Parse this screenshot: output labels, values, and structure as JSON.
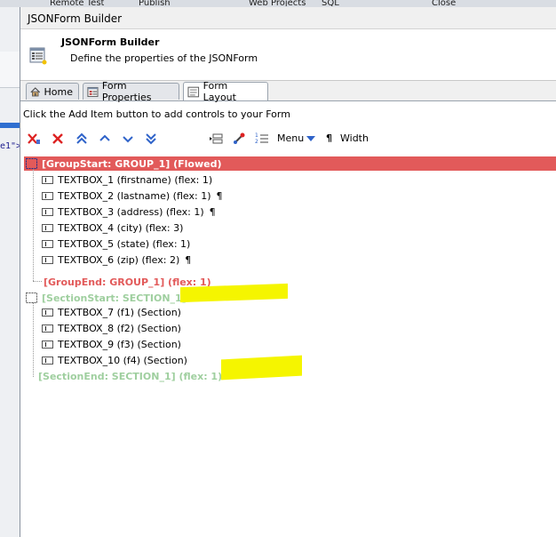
{
  "background": {
    "tabs": [
      "Remote Test",
      "Publish",
      "Web Projects",
      "SQL",
      "Close"
    ],
    "code_fragment": "e1\">"
  },
  "dialog": {
    "title": "JSONForm Builder",
    "banner_title": "JSONForm Builder",
    "banner_subtitle": "Define the properties of the JSONForm",
    "tabs": [
      {
        "label": "Home",
        "icon": "home-icon"
      },
      {
        "label": "Form Properties",
        "icon": "properties-icon"
      },
      {
        "label": "Form Layout",
        "icon": "layout-icon",
        "active": true
      }
    ],
    "hint": "Click the Add Item button to add controls to your Form",
    "toolbar": {
      "menu_label": "Menu",
      "pilcrow": "¶",
      "width_label": "Width"
    },
    "tree": {
      "group_start": "[GroupStart: GROUP_1] (Flowed)",
      "group_items": [
        {
          "label": "TEXTBOX_1 (firstname) (flex: 1)",
          "break": false
        },
        {
          "label": "TEXTBOX_2 (lastname) (flex: 1)",
          "break": true
        },
        {
          "label": "TEXTBOX_3 (address) (flex: 1)",
          "break": true
        },
        {
          "label": "TEXTBOX_4 (city) (flex: 3)",
          "break": false
        },
        {
          "label": "TEXTBOX_5 (state) (flex: 1)",
          "break": false
        },
        {
          "label": "TEXTBOX_6 (zip) (flex: 2)",
          "break": true
        }
      ],
      "group_end": "[GroupEnd: GROUP_1] (flex: 1)",
      "section_start": "[SectionStart: SECTION_1]",
      "section_items": [
        {
          "label": "TEXTBOX_7 (f1) (Section)"
        },
        {
          "label": "TEXTBOX_8 (f2) (Section)"
        },
        {
          "label": "TEXTBOX_9 (f3) (Section)"
        },
        {
          "label": "TEXTBOX_10 (f4) (Section)"
        }
      ],
      "section_end": "[SectionEnd: SECTION_1] (flex: 1)",
      "pilcrow": "¶"
    }
  },
  "colors": {
    "selection": "#e25a5a",
    "section_text": "#9fcf9f",
    "highlight": "#f5f500"
  }
}
